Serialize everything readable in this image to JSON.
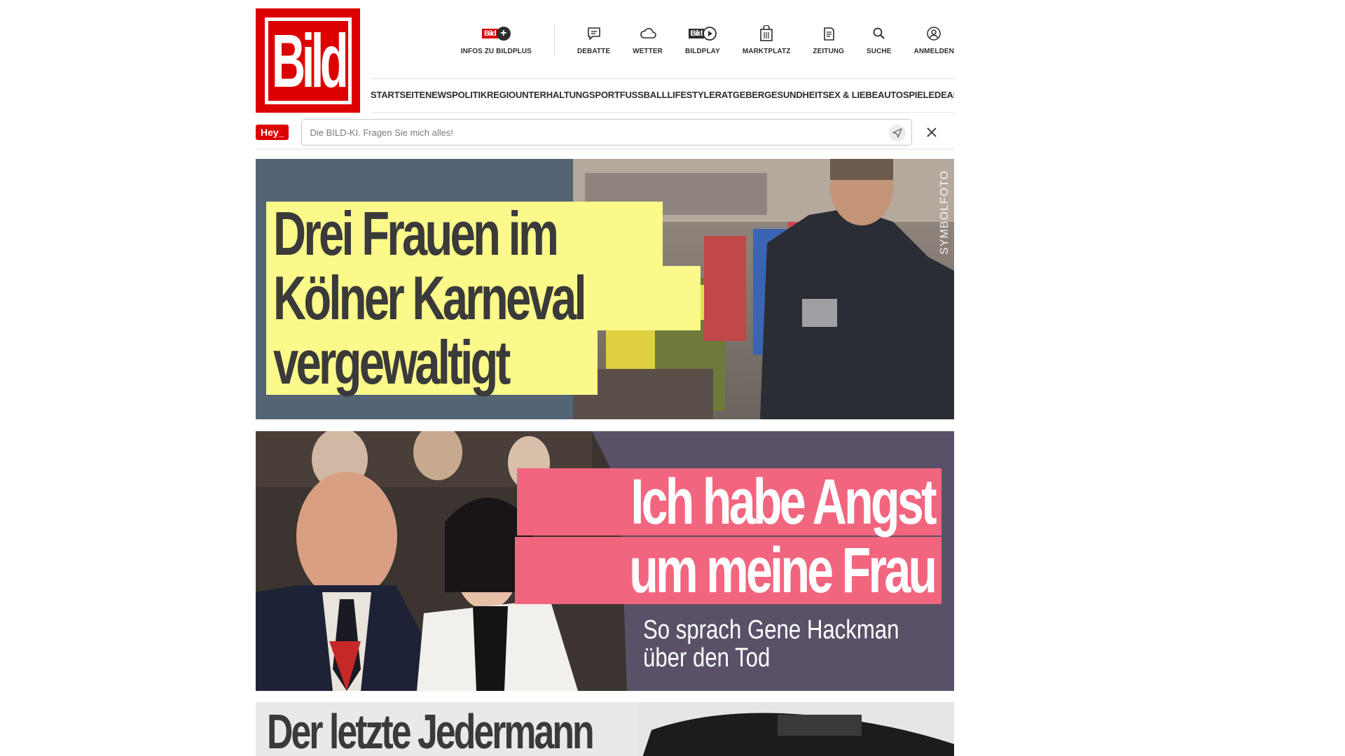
{
  "logo": {
    "text": "Bild"
  },
  "services": [
    {
      "label": "INFOS ZU BILDPLUS",
      "icon": "bildplus-icon"
    },
    {
      "label": "DEBATTE",
      "icon": "chat-bubble-icon"
    },
    {
      "label": "WETTER",
      "icon": "cloud-icon"
    },
    {
      "label": "BILDPLAY",
      "icon": "play-icon"
    },
    {
      "label": "MARKTPLATZ",
      "icon": "shopping-bag-icon"
    },
    {
      "label": "ZEITUNG",
      "icon": "newspaper-icon"
    },
    {
      "label": "SUCHE",
      "icon": "search-icon"
    },
    {
      "label": "ANMELDEN",
      "icon": "user-icon"
    }
  ],
  "bildplus_mini": "Bild",
  "nav": [
    "STARTSEITE",
    "NEWS",
    "POLITIK",
    "REGIO",
    "UNTERHALTUNG",
    "SPORT",
    "FUSSBALL",
    "LIFESTYLE",
    "RATGEBER",
    "GESUNDHEIT",
    "SEX & LIEBE",
    "AUTO",
    "SPIELE",
    "DEALS"
  ],
  "ai": {
    "badge": "Hey_",
    "placeholder": "Die BILD-KI. Fragen Sie mich alles!"
  },
  "teasers": [
    {
      "headline_lines": [
        "Drei Frauen im",
        "Kölner Karneval",
        "vergewaltigt"
      ],
      "photo_label": "SYMBOLFOTO",
      "colors": {
        "background": "#536474",
        "highlight": "#fbf98a"
      }
    },
    {
      "headline_lines": [
        "Ich habe Angst",
        "um meine Frau"
      ],
      "subline_lines": [
        "So sprach Gene Hackman",
        "über den Tod"
      ],
      "colors": {
        "background": "#5a5168",
        "highlight": "#f2657f"
      }
    },
    {
      "headline": "Der letzte Jedermann"
    }
  ],
  "colors": {
    "brand": "#dd0000"
  }
}
